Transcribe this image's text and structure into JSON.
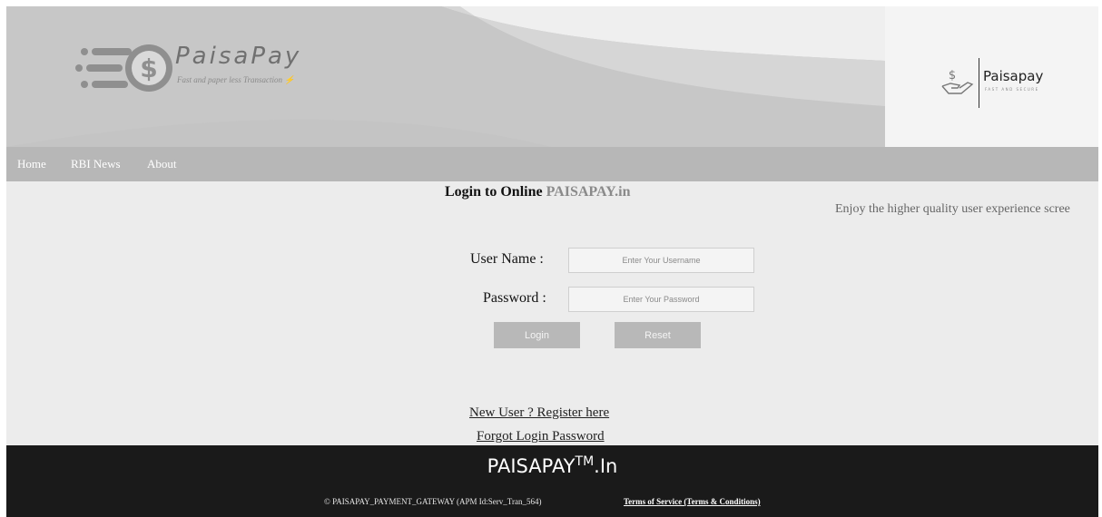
{
  "header": {
    "logo_title": "PaisaPay",
    "logo_tagline": "Fast and paper less Transaction ⚡",
    "brand_name": "Paisapay",
    "brand_tagline": "FAST AND SECURE"
  },
  "nav": {
    "items": [
      {
        "label": "Home"
      },
      {
        "label": "RBI News"
      },
      {
        "label": "About"
      }
    ]
  },
  "login": {
    "title_prefix": "Login to Online ",
    "title_accent": "PAISAPAY.in",
    "marquee_text": "Enjoy the higher quality user experience scree",
    "username_label": "User Name :",
    "username_placeholder": "Enter Your Username",
    "username_value": "",
    "password_label": "Password :",
    "password_placeholder": "Enter Your Password",
    "password_value": "",
    "login_button": "Login",
    "reset_button": "Reset",
    "register_link": "New User ? Register here",
    "forgot_link": "Forgot Login Password"
  },
  "footer": {
    "brand": "PAISAPAY",
    "brand_sup": "TM",
    "brand_suffix": ".In",
    "copyright": "© PAISAPAY_PAYMENT_GATEWAY (APM Id:Serv_Tran_564)",
    "terms": "Terms of Service (Terms & Conditions)"
  },
  "colors": {
    "banner": "#c7c7c7",
    "nav": "#b7b7b7",
    "button": "#b8b8b8",
    "footer": "#1a1a1a"
  },
  "icons": [
    "dollar-coin-logo-icon",
    "hand-dollar-icon"
  ]
}
